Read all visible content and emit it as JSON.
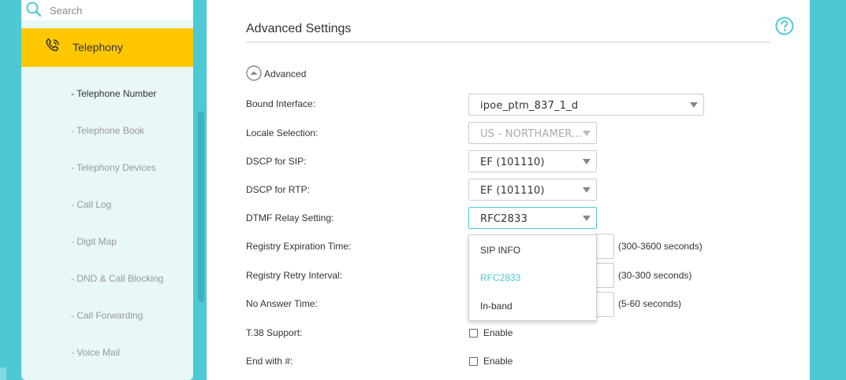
{
  "search": {
    "placeholder": "Search"
  },
  "sidebar": {
    "header_label": "Telephony",
    "items": [
      {
        "label": "- Telephone Number",
        "active": true
      },
      {
        "label": "- Telephone Book",
        "active": false
      },
      {
        "label": "- Telephony Devices",
        "active": false
      },
      {
        "label": "- Call Log",
        "active": false
      },
      {
        "label": "- Digit Map",
        "active": false
      },
      {
        "label": "- DND & Call Blocking",
        "active": false
      },
      {
        "label": "- Call Forwarding",
        "active": false
      },
      {
        "label": "- Voice Mail",
        "active": false
      }
    ]
  },
  "main": {
    "title": "Advanced Settings",
    "advanced_toggle": "Advanced",
    "fields": {
      "bound_interface": {
        "label": "Bound Interface:",
        "value": "ipoe_ptm_837_1_d"
      },
      "locale_selection": {
        "label": "Locale Selection:",
        "value": "US - NORTHAMER..."
      },
      "dscp_sip": {
        "label": "DSCP for SIP:",
        "value": "EF (101110)"
      },
      "dscp_rtp": {
        "label": "DSCP for RTP:",
        "value": "EF (101110)"
      },
      "dtmf_relay": {
        "label": "DTMF Relay Setting:",
        "value": "RFC2833"
      },
      "registry_expiration": {
        "label": "Registry Expiration Time:",
        "unit": "(300-3600 seconds)"
      },
      "registry_retry": {
        "label": "Registry Retry Interval:",
        "unit": "(30-300 seconds)"
      },
      "no_answer": {
        "label": "No Answer Time:",
        "unit": "(5-60 seconds)"
      },
      "t38": {
        "label": "T.38 Support:",
        "checkbox_label": "Enable",
        "checked": false
      },
      "end_with_hash": {
        "label": "End with #:",
        "checkbox_label": "Enable",
        "checked": false
      }
    },
    "dtmf_dropdown": {
      "options": [
        "SIP INFO",
        "RFC2833",
        "In-band"
      ],
      "selected": "RFC2833"
    }
  },
  "colors": {
    "background": "#4ec9d4",
    "accent": "#4ec9d4",
    "sidebar_active": "#ffc700",
    "sidebar_bg": "#e8f7f8"
  }
}
